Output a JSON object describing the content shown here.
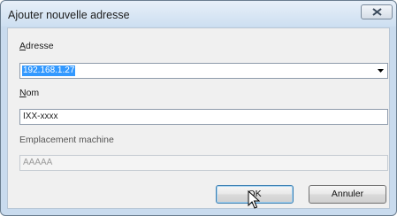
{
  "window": {
    "title": "Ajouter nouvelle adresse"
  },
  "fields": {
    "address_label_mnemonic": "A",
    "address_label_rest": "dresse",
    "address_value": "192.168.1.27",
    "name_label_mnemonic": "N",
    "name_label_rest": "om",
    "name_value": "IXX-xxxx",
    "location_label": "Emplacement machine",
    "location_value": "AAAAA"
  },
  "buttons": {
    "ok_label": "OK",
    "cancel_label": "Annuler"
  },
  "colors": {
    "selection": "#3399ff",
    "default_button_border": "#3c7fb1"
  },
  "icons": {
    "close": "close-icon",
    "dropdown": "chevron-down-icon",
    "cursor": "mouse-pointer-icon"
  }
}
